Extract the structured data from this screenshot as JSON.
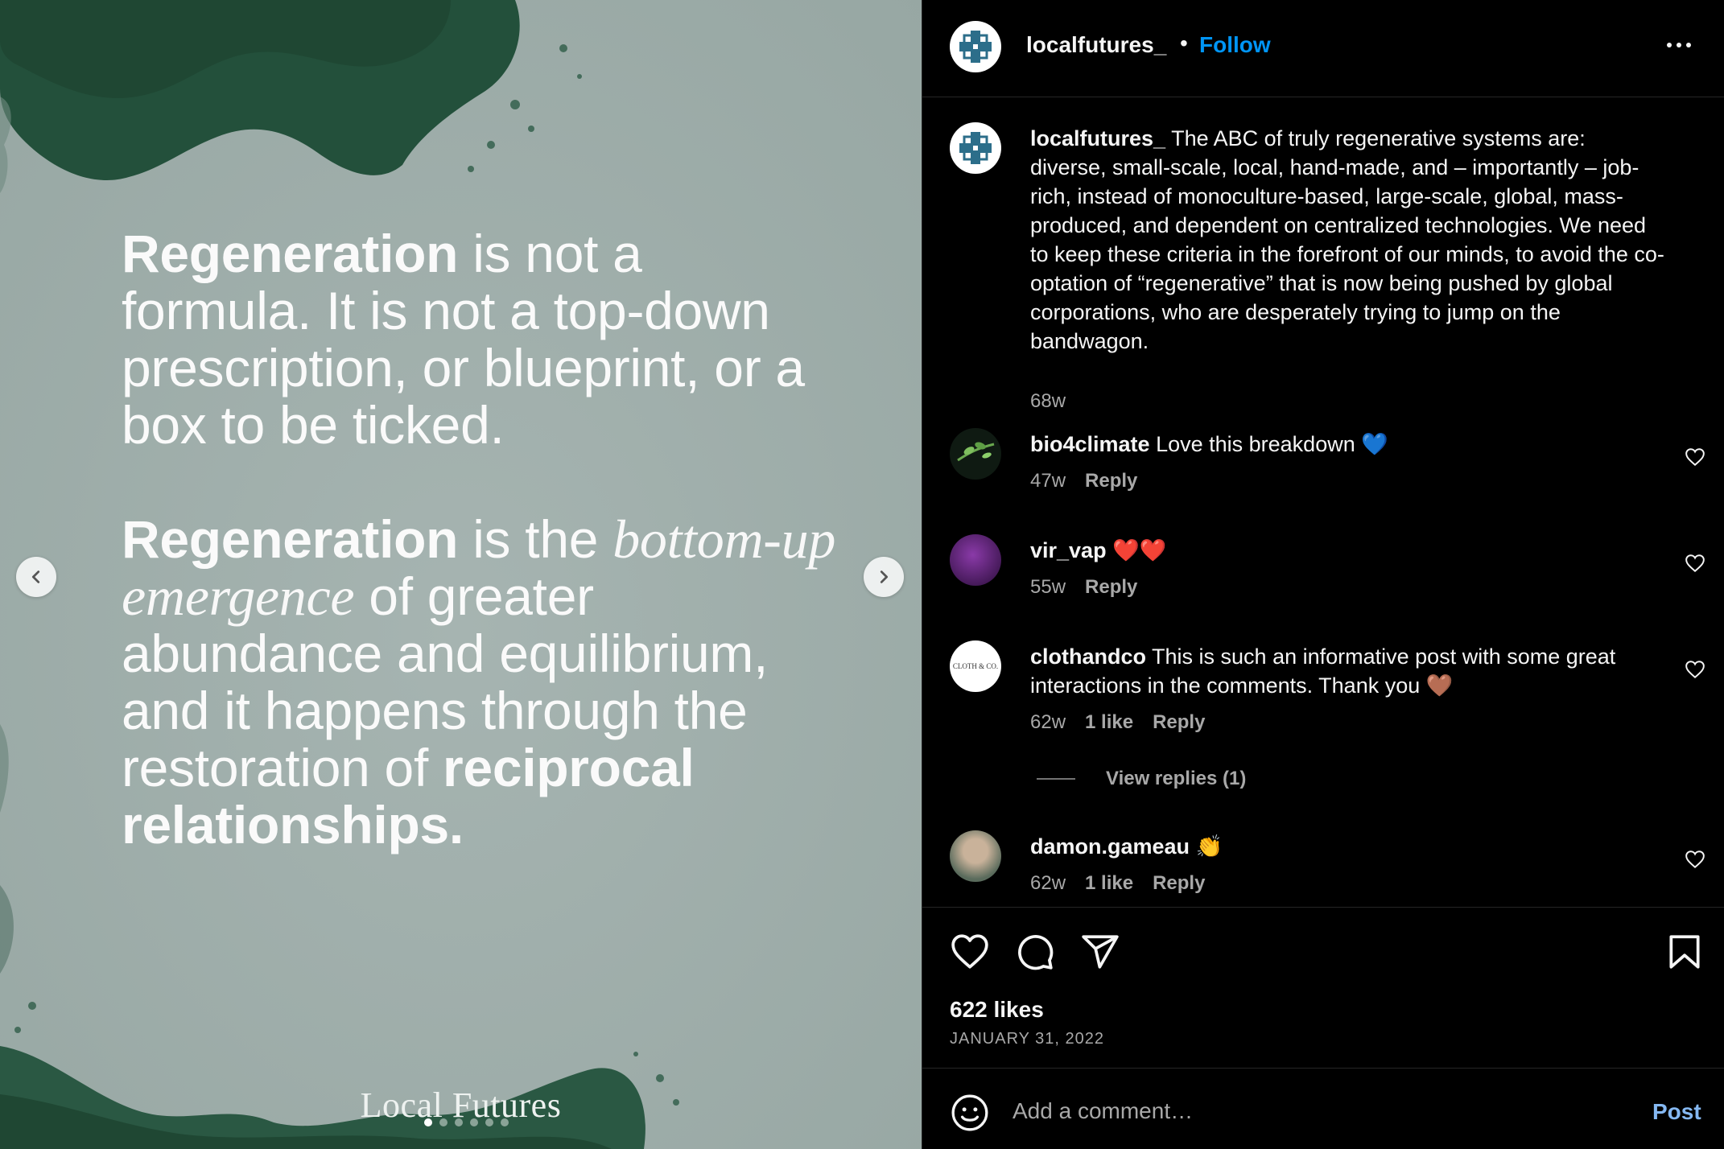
{
  "media": {
    "quote": {
      "p1_bold": "Regeneration",
      "p1_rest": " is not a formula. It is not a top-down prescription, or blueprint, or a box to be ticked.",
      "p2_bold": "Regeneration",
      "p2_a": " is the ",
      "p2_italic": "bottom-up emergence",
      "p2_b": " of greater abundance and equilibrium, and it happens through the restoration of ",
      "p2_bold_end": "reciprocal relationships."
    },
    "brand": "Local Futures",
    "carousel": {
      "count": 6,
      "active": 1
    }
  },
  "header": {
    "username": "localfutures_",
    "separator": "•",
    "follow_label": "Follow"
  },
  "caption": {
    "username": "localfutures_",
    "text": "The ABC of truly regenerative systems are: diverse, small-scale, local, hand-made, and – importantly – job-rich, instead of monoculture-based, large-scale, global, mass-produced, and dependent on centralized technologies. We need to keep these criteria in the forefront of our minds, to avoid the co-optation of “regenerative” that is now being pushed by global corporations, who are desperately trying to jump on the bandwagon.",
    "time": "68w"
  },
  "comments": [
    {
      "username": "bio4climate",
      "text": "Love this breakdown 💙",
      "time": "47w",
      "likes": "",
      "reply": "Reply"
    },
    {
      "username": "vir_vap",
      "text": "❤️❤️",
      "time": "55w",
      "likes": "",
      "reply": "Reply"
    },
    {
      "username": "clothandco",
      "text": "This is such an informative post with some great interactions in the comments. Thank you 🤎",
      "time": "62w",
      "likes": "1 like",
      "reply": "Reply",
      "avatar_text": "CLOTH & CO."
    },
    {
      "username": "damon.gameau",
      "text": "👏",
      "time": "62w",
      "likes": "1 like",
      "reply": "Reply"
    }
  ],
  "view_replies": "View replies (1)",
  "actions": {
    "likes": "622 likes",
    "date": "JANUARY 31, 2022"
  },
  "add_comment": {
    "placeholder": "Add a comment…",
    "post_label": "Post"
  },
  "colors": {
    "follow": "#0095f6",
    "post": "#85b8f2",
    "background": "#000000",
    "media_bg": "#a3b1ae",
    "media_dark": "#1f4a36"
  },
  "icons": [
    "chevron-left-icon",
    "chevron-right-icon",
    "more-icon",
    "heart-icon",
    "comment-icon",
    "share-icon",
    "bookmark-icon",
    "emoji-icon"
  ]
}
